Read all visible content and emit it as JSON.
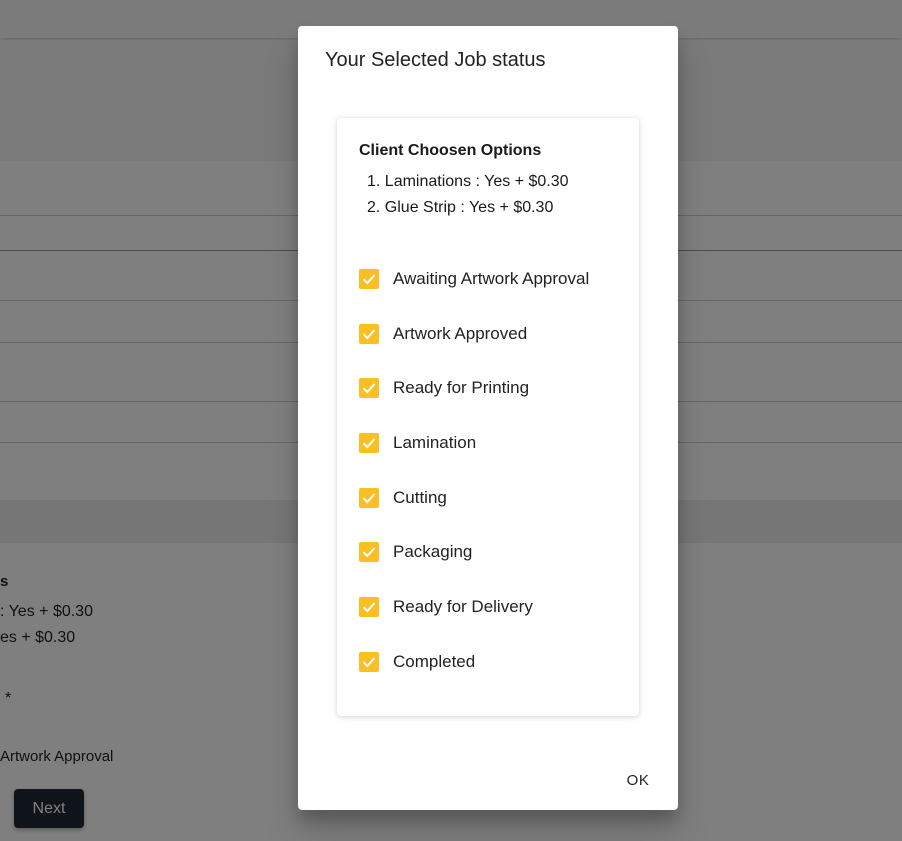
{
  "background": {
    "options_heading": "s",
    "option_1": ": Yes + $0.30",
    "option_2": "es + $0.30",
    "required_marker": "*",
    "status_text": "Artwork Approval",
    "next_label": "Next"
  },
  "dialog": {
    "title": "Your Selected Job status",
    "card": {
      "heading": "Client Choosen Options",
      "options": [
        "1. Laminations : Yes + $0.30",
        "2. Glue Strip : Yes + $0.30"
      ]
    },
    "statuses": [
      {
        "label": "Awaiting Artwork Approval",
        "checked": true
      },
      {
        "label": "Artwork Approved",
        "checked": true
      },
      {
        "label": "Ready for Printing",
        "checked": true
      },
      {
        "label": "Lamination",
        "checked": true
      },
      {
        "label": "Cutting",
        "checked": true
      },
      {
        "label": "Packaging",
        "checked": true
      },
      {
        "label": "Ready for Delivery",
        "checked": true
      },
      {
        "label": "Completed",
        "checked": true
      }
    ],
    "ok_label": "OK"
  },
  "colors": {
    "checkbox": "#fbbf24",
    "next_button": "#1f2937",
    "overlay": "rgba(0,0,0,0.5)"
  },
  "icons": {
    "checkbox": "check-icon"
  }
}
